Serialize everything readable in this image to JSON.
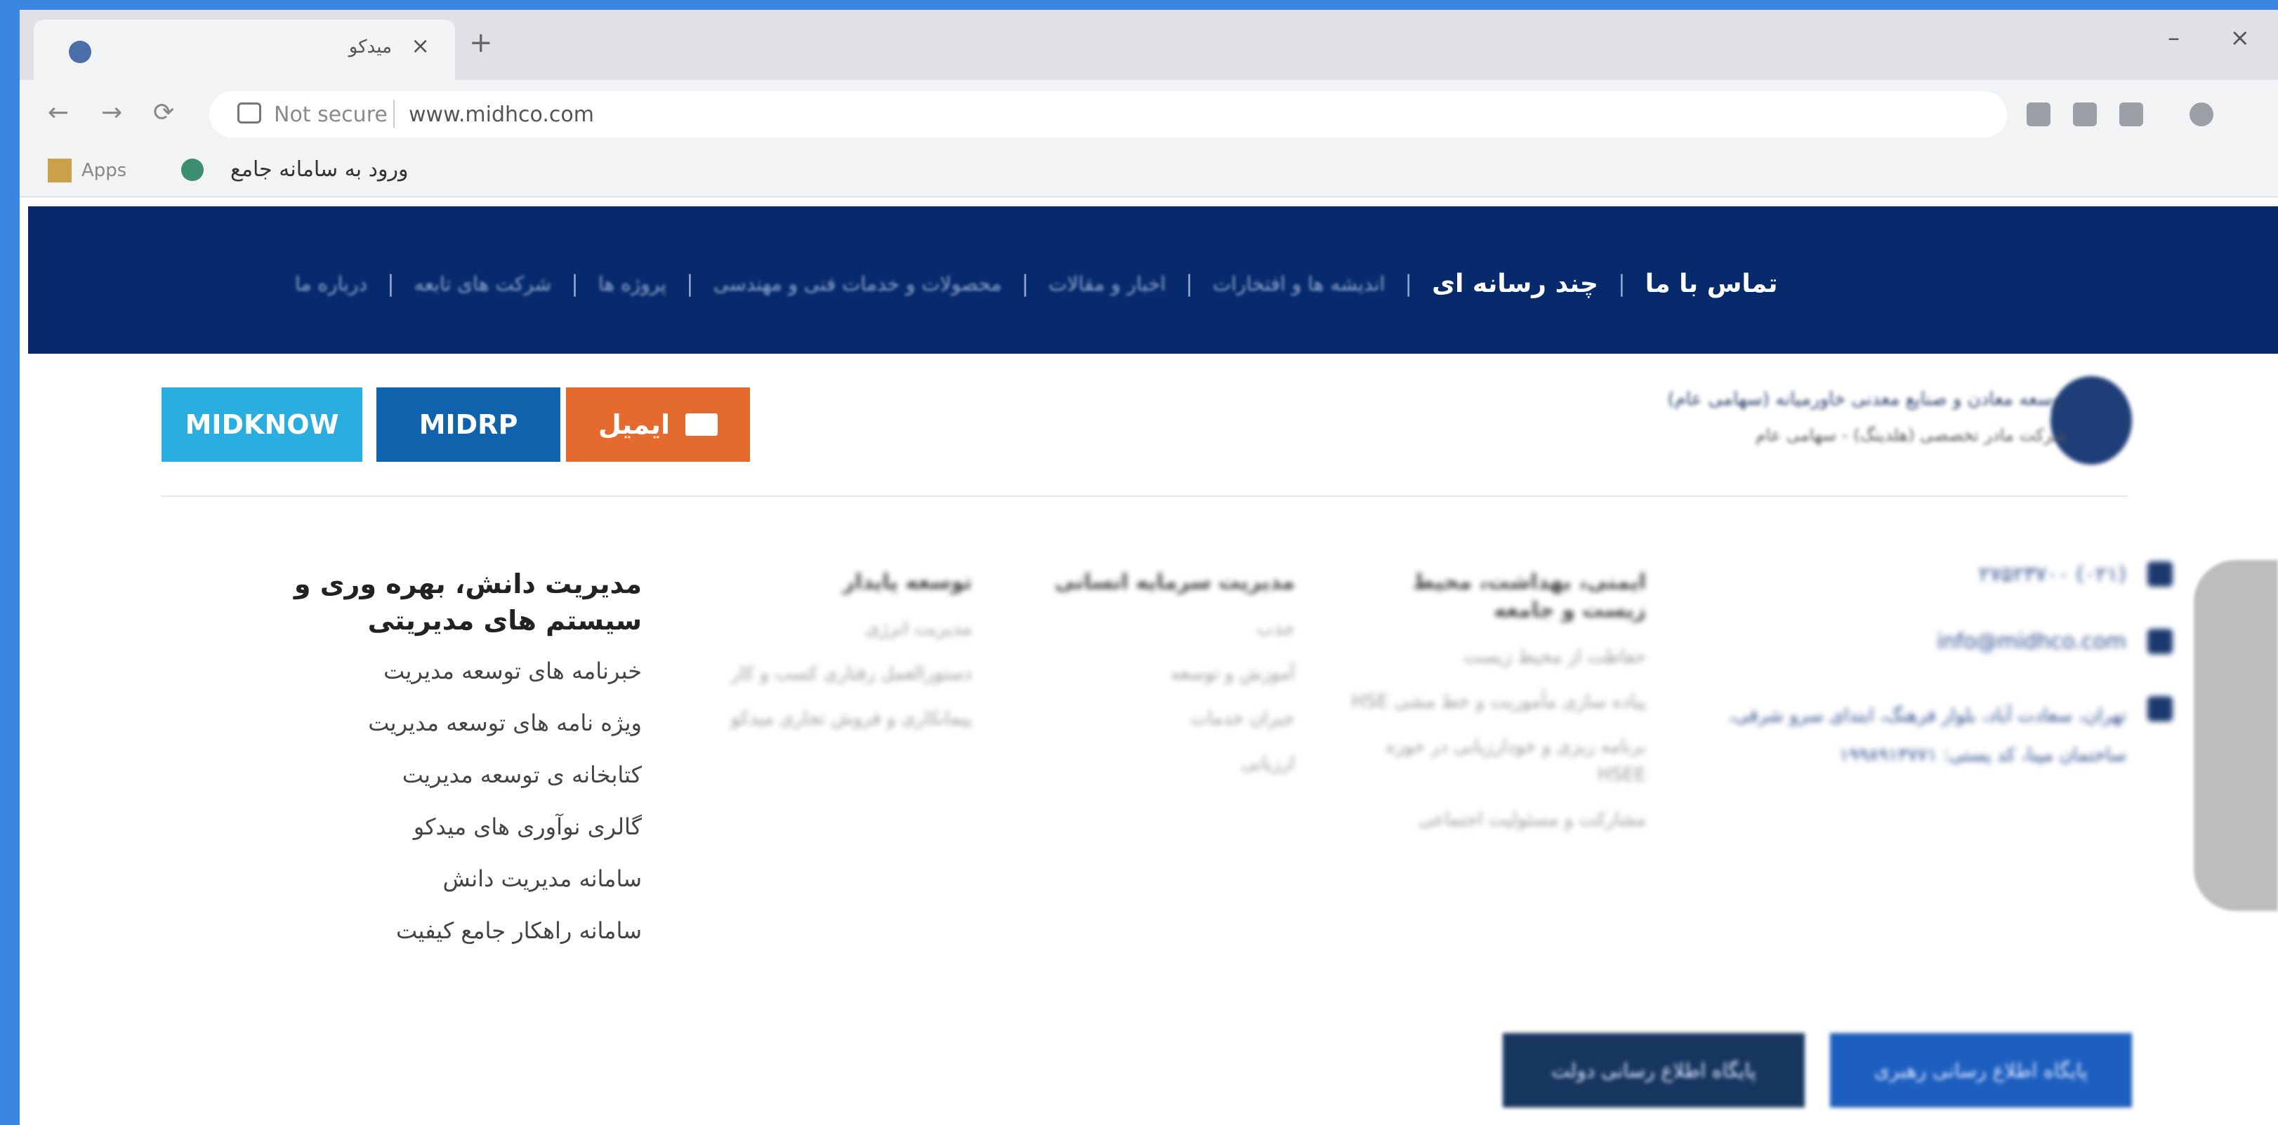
{
  "browser": {
    "tab_title": "میدکو",
    "tab_close": "×",
    "new_tab": "+",
    "window_controls": [
      "–",
      "×"
    ],
    "nav": {
      "back": "←",
      "forward": "→",
      "reload": "⟳"
    },
    "address": {
      "security": "Not secure",
      "url": "www.midhco.com"
    },
    "bookmarks": {
      "apps_label": "Apps",
      "item_label": "ورود به سامانه جامع"
    }
  },
  "site_nav": {
    "items": [
      "درباره ما",
      "شرکت های تابعه",
      "پروژه ها",
      "محصولات و خدمات فنی و مهندسی",
      "اخبار و مقالات",
      "اندیشه ها و افتخارات",
      "چند رسانه ای",
      "تماس با ما"
    ],
    "separator": "|"
  },
  "header": {
    "logo_line1": "توسعه معادن و صنایع معدنی خاورمیانه (سهامی عام)",
    "logo_line2": "شرکت مادر تخصصی (هلدینگ) - سهامی عام",
    "buttons": {
      "email": "ایمیل",
      "midrp": "MIDRP",
      "midknow": "MIDKNOW"
    }
  },
  "footer": {
    "contact": {
      "phone": "(۰۲۱) ۲۷۵۲۳۷۰۰",
      "email": "info@midhco.com",
      "address": "تهران، سعادت آباد، بلوار فرهنگ، ابتدای سرو شرقی، ساختمان مپنا، کد پستی: ۱۹۹۸۹۱۳۷۷۱"
    },
    "columns": [
      {
        "title": "ایمنی، بهداشت، محیط زیست و جامعه",
        "items": [
          "حفاظت از محیط زیست",
          "پیاده سازی مأموریت و خط مشی HSE",
          "برنامه ریزی و خودارزیابی در حوزه HSEE",
          "مشارکت و مسئولیت اجتماعی"
        ]
      },
      {
        "title": "مدیریت سرمایه انسانی",
        "items": [
          "جذب",
          "آموزش و توسعه",
          "جبران خدمات",
          "ارزیابی"
        ]
      },
      {
        "title": "توسعه پایدار",
        "items": [
          "مدیریت انرژی",
          "دستورالعمل رفتاری کسب و کار",
          "پیمانکاری و فروش تجاری میدکو"
        ]
      },
      {
        "title": "مدیریت دانش، بهره وری و سیستم های مدیریتی",
        "items": [
          "خبرنامه های توسعه مدیریت",
          "ویژه نامه های توسعه مدیریت",
          "کتابخانه ی توسعه مدیریت",
          "گالری نوآوری های میدکو",
          "سامانه مدیریت دانش",
          "سامانه راهکار جامع کیفیت"
        ]
      }
    ],
    "bottom_buttons": [
      "پایگاه اطلاع رسانی رهبری",
      "پایگاه اطلاع رسانی دولت"
    ]
  },
  "colors": {
    "nav_bg": "#062a6b",
    "email_btn": "#e46a2e",
    "midrp_btn": "#0f63ad",
    "midknow_btn": "#2aaee0"
  }
}
